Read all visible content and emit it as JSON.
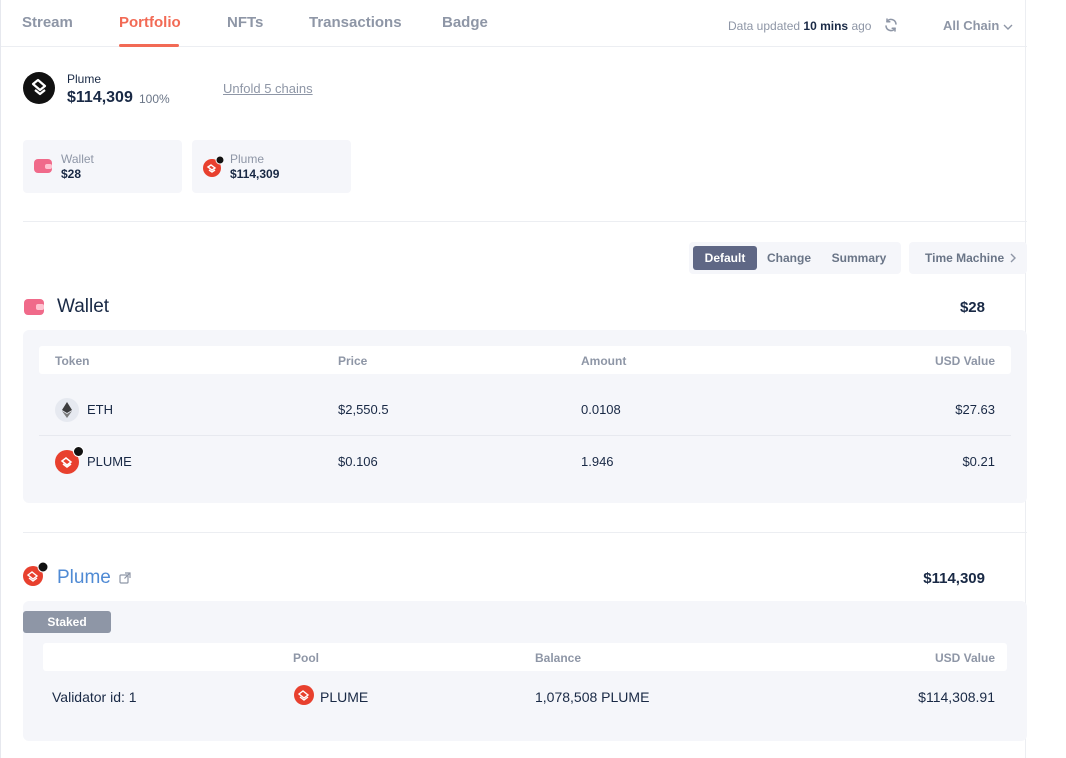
{
  "nav": {
    "tabs": [
      {
        "label": "Stream"
      },
      {
        "label": "Portfolio"
      },
      {
        "label": "NFTs"
      },
      {
        "label": "Transactions"
      },
      {
        "label": "Badge"
      }
    ],
    "active_tab": "Portfolio",
    "data_updated_prefix": "Data updated",
    "data_updated_value": "10 mins",
    "data_updated_suffix": "ago",
    "chain_filter": "All Chain"
  },
  "summary": {
    "name": "Plume",
    "total": "$114,309",
    "percent": "100%",
    "unfold_label": "Unfold 5 chains"
  },
  "chips": [
    {
      "label": "Wallet",
      "value": "$28",
      "icon": "wallet-icon"
    },
    {
      "label": "Plume",
      "value": "$114,309",
      "icon": "plume-icon"
    }
  ],
  "views": {
    "options": [
      "Default",
      "Change",
      "Summary"
    ],
    "active": "Default",
    "time_machine": "Time Machine"
  },
  "wallet": {
    "title": "Wallet",
    "total": "$28",
    "columns": [
      "Token",
      "Price",
      "Amount",
      "USD Value"
    ],
    "rows": [
      {
        "token": "ETH",
        "price": "$2,550.5",
        "amount": "0.0108",
        "usd": "$27.63",
        "icon": "eth-icon"
      },
      {
        "token": "PLUME",
        "price": "$0.106",
        "amount": "1.946",
        "usd": "$0.21",
        "icon": "plume-icon"
      }
    ]
  },
  "plume_protocol": {
    "title": "Plume",
    "total": "$114,309",
    "tag": "Staked",
    "columns": [
      "",
      "Pool",
      "Balance",
      "USD Value"
    ],
    "rows": [
      {
        "label": "Validator id: 1",
        "pool": "PLUME",
        "balance": "1,078,508 PLUME",
        "usd": "$114,308.91"
      }
    ]
  },
  "colors": {
    "accent": "#f26a55",
    "link": "#4f8ad4",
    "panel": "#f5f6fa",
    "active_toggle": "#5f6785",
    "plume_red": "#e8402e"
  }
}
